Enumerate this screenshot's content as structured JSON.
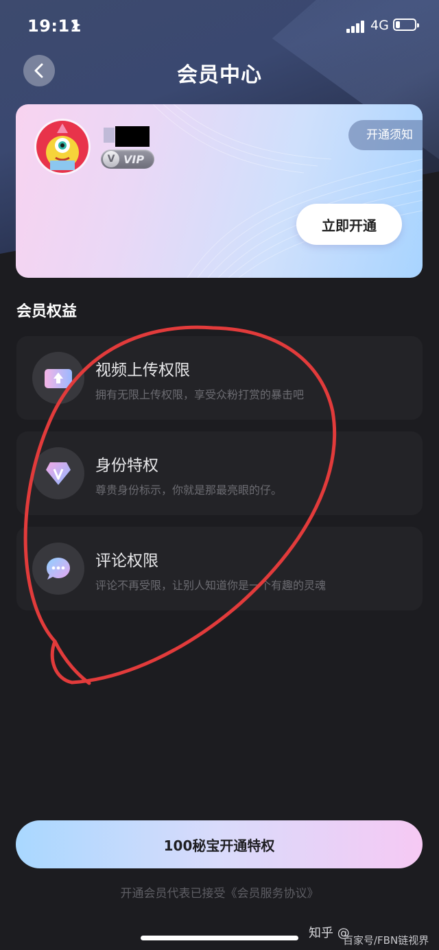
{
  "status_bar": {
    "time": "19:11",
    "location_glyph": "➤",
    "network": "4G"
  },
  "header": {
    "title": "会员中心"
  },
  "member_card": {
    "vip_label": "VIP",
    "notice_label": "开通须知",
    "open_now_label": "立即开通"
  },
  "benefits": {
    "section_title": "会员权益",
    "items": [
      {
        "title": "视频上传权限",
        "desc": "拥有无限上传权限，享受众粉打赏的暴击吧",
        "icon": "upload-icon"
      },
      {
        "title": "身份特权",
        "desc": "尊贵身份标示，你就是那最亮眼的仔。",
        "icon": "vip-gem-icon"
      },
      {
        "title": "评论权限",
        "desc": "评论不再受限，让别人知道你是一个有趣的灵魂",
        "icon": "comment-bubble-icon"
      }
    ]
  },
  "cta": {
    "label": "100秘宝开通特权"
  },
  "agreement": {
    "text": "开通会员代表已接受《会员服务协议》"
  },
  "watermark": {
    "line1": "知乎 @",
    "line2": "百家号/FBN链视界"
  },
  "colors": {
    "annotation_circle": "#e23b3b",
    "card_gradient_start": "#f8d3f0",
    "card_gradient_end": "#a8d4ff"
  }
}
